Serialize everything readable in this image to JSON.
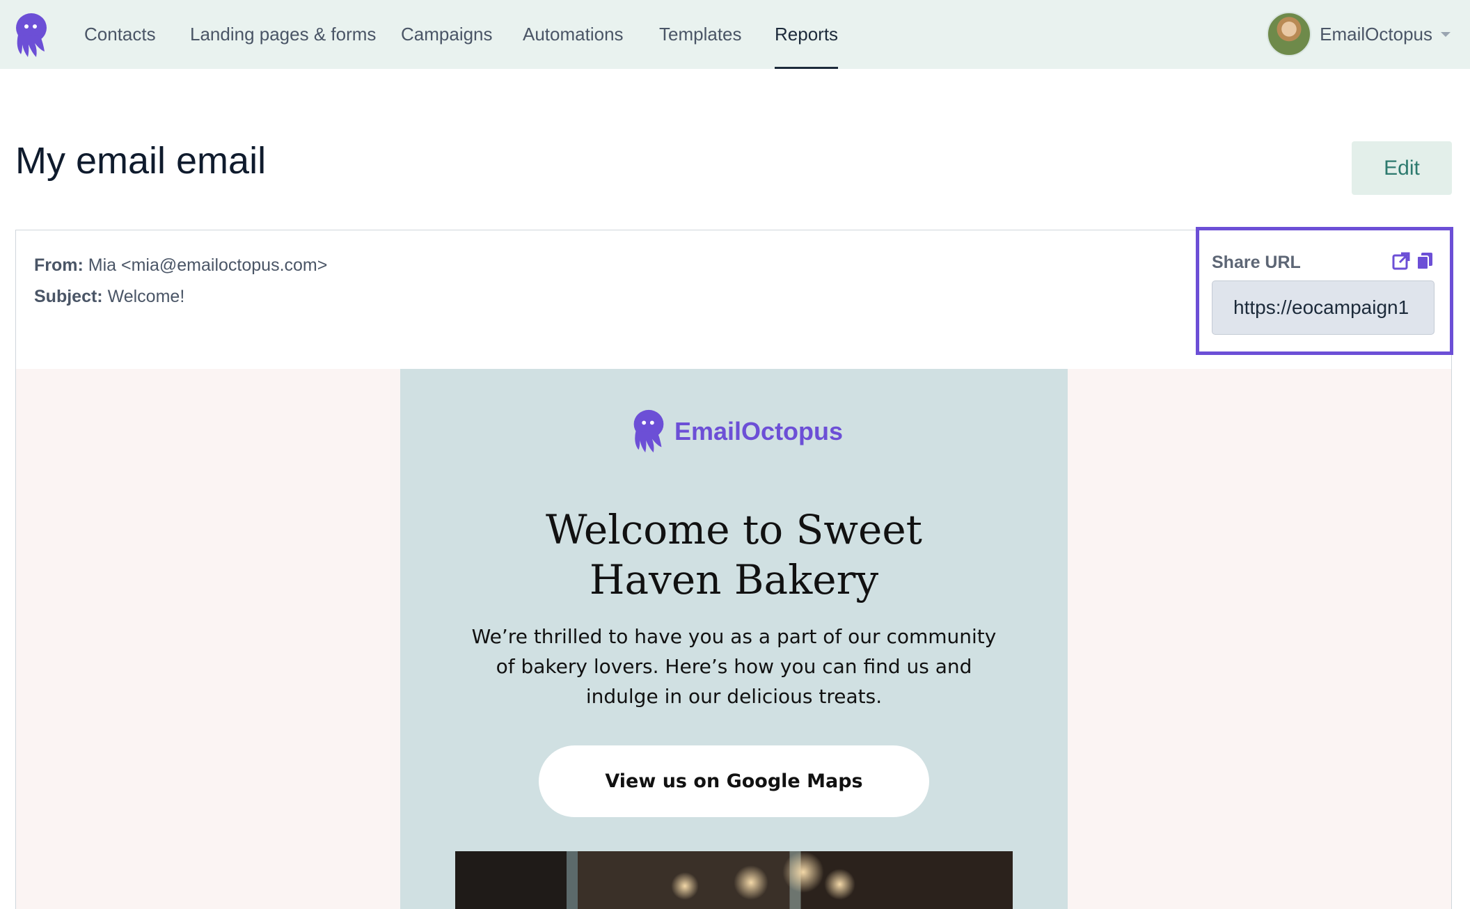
{
  "nav": {
    "items": [
      {
        "label": "Contacts"
      },
      {
        "label": "Landing pages & forms"
      },
      {
        "label": "Campaigns"
      },
      {
        "label": "Automations"
      },
      {
        "label": "Templates"
      },
      {
        "label": "Reports",
        "active": true
      }
    ],
    "account_name": "EmailOctopus"
  },
  "page": {
    "title": "My email email",
    "edit_label": "Edit"
  },
  "email_meta": {
    "from_label": "From:",
    "from_value": "Mia <mia@emailoctopus.com>",
    "subject_label": "Subject:",
    "subject_value": "Welcome!"
  },
  "share": {
    "label": "Share URL",
    "url": "https://eocampaign1"
  },
  "preview": {
    "brand": "EmailOctopus",
    "title_line1": "Welcome to Sweet",
    "title_line2": "Haven Bakery",
    "body": "We’re thrilled to have you as a part of our community of bakery lovers. Here’s how you can find us and indulge in our delicious treats.",
    "button_label": "View us on Google Maps"
  },
  "colors": {
    "accent": "#6c4fd6",
    "nav_bg": "#e9f2ef",
    "edit_bg": "#e3efea",
    "email_bg": "#d0e0e2",
    "preview_bg": "#fbf4f3"
  }
}
